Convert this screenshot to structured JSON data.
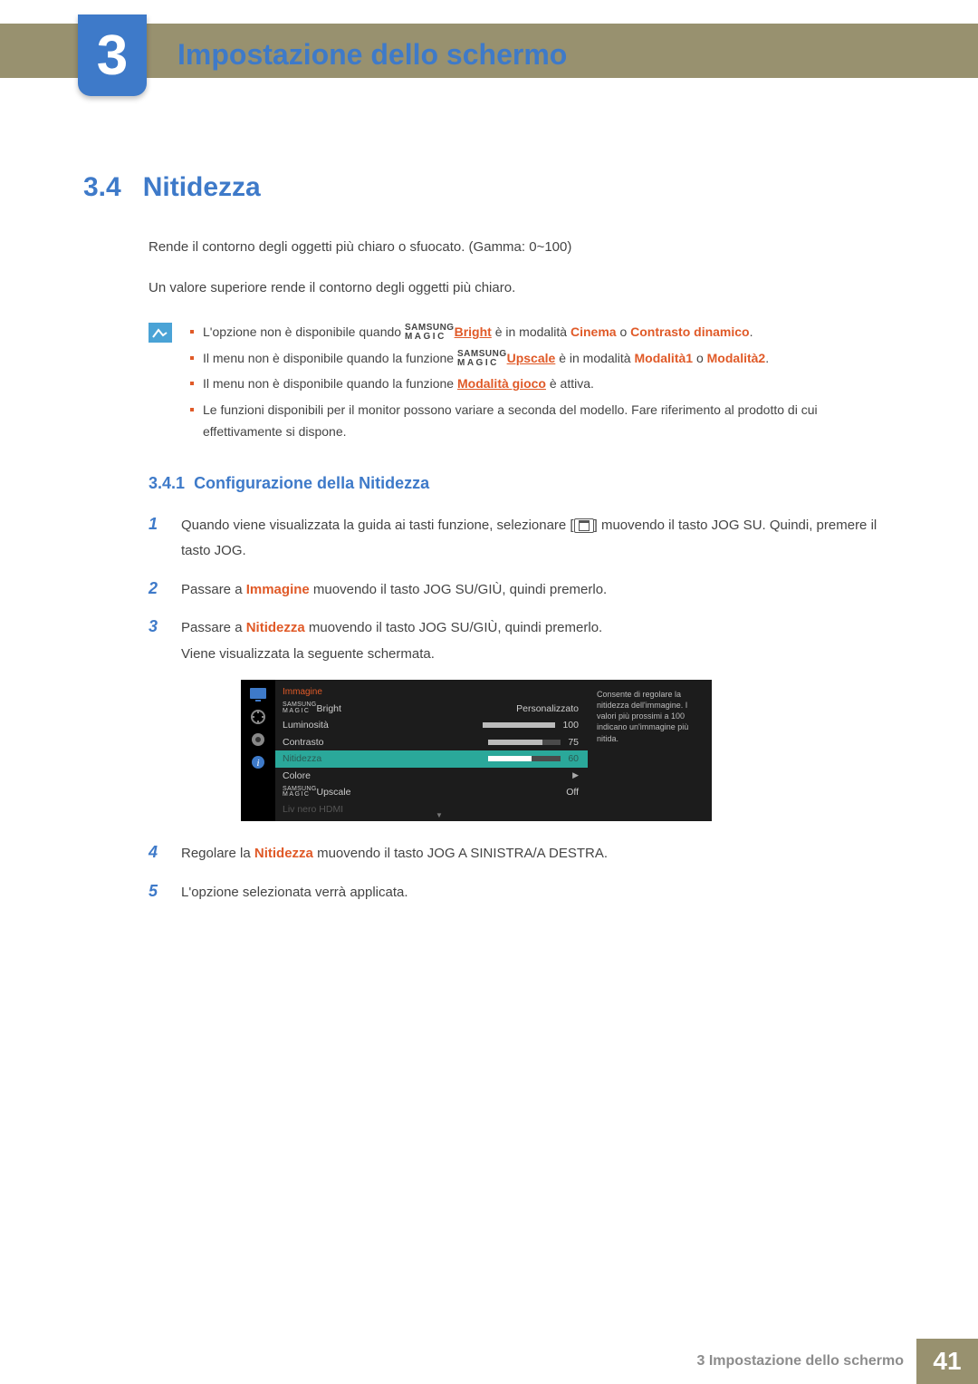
{
  "chapter": {
    "number": "3",
    "title": "Impostazione dello schermo"
  },
  "section": {
    "number": "3.4",
    "title": "Nitidezza",
    "intro1": "Rende il contorno degli oggetti più chiaro o sfuocato. (Gamma: 0~100)",
    "intro2": "Un valore superiore rende il contorno degli oggetti più chiaro."
  },
  "notes": {
    "n1_a": "L'opzione non è disponibile quando ",
    "n1_brand_top": "SAMSUNG",
    "n1_brand_bot": "MAGIC",
    "n1_b": "Bright",
    "n1_c": " è in modalità ",
    "n1_d": "Cinema",
    "n1_e": " o ",
    "n1_f": "Contrasto dinamico",
    "n1_g": ".",
    "n2_a": "Il menu non è disponibile quando la funzione ",
    "n2_b": "Upscale",
    "n2_c": " è in modalità ",
    "n2_d": "Modalità1",
    "n2_e": " o ",
    "n2_f": "Modalità2",
    "n2_g": ".",
    "n3_a": "Il menu non è disponibile quando la funzione ",
    "n3_b": "Modalità gioco",
    "n3_c": " è attiva.",
    "n4": "Le funzioni disponibili per il monitor possono variare a seconda del modello. Fare riferimento al prodotto di cui effettivamente si dispone."
  },
  "subsection": {
    "number": "3.4.1",
    "title": "Configurazione della Nitidezza"
  },
  "steps": {
    "s1_num": "1",
    "s1_a": "Quando viene visualizzata la guida ai tasti funzione, selezionare [",
    "s1_b": "] muovendo il tasto JOG SU. Quindi, premere il tasto JOG.",
    "s2_num": "2",
    "s2_a": "Passare a ",
    "s2_b": "Immagine",
    "s2_c": " muovendo il tasto JOG SU/GIÙ, quindi premerlo.",
    "s3_num": "3",
    "s3_a": "Passare a ",
    "s3_b": "Nitidezza",
    "s3_c": " muovendo il tasto JOG SU/GIÙ, quindi premerlo.",
    "s3_d": "Viene visualizzata la seguente schermata.",
    "s4_num": "4",
    "s4_a": "Regolare la ",
    "s4_b": "Nitidezza",
    "s4_c": " muovendo il tasto JOG A SINISTRA/A DESTRA.",
    "s5_num": "5",
    "s5_a": "L'opzione selezionata verrà applicata."
  },
  "osd": {
    "title": "Immagine",
    "brand_top": "SAMSUNG",
    "brand_bot": "MAGIC",
    "r1_label": "Bright",
    "r1_val": "Personalizzato",
    "r2_label": "Luminosità",
    "r2_val": "100",
    "r3_label": "Contrasto",
    "r3_val": "75",
    "r4_label": "Nitidezza",
    "r4_val": "60",
    "r5_label": "Colore",
    "r6_label": "Upscale",
    "r6_val": "Off",
    "r7_label": "Liv nero HDMI",
    "info": "Consente di regolare la nitidezza dell'immagine. I valori più prossimi a 100 indicano un'immagine più nitida."
  },
  "chart_data": {
    "type": "bar",
    "categories": [
      "Luminosità",
      "Contrasto",
      "Nitidezza"
    ],
    "values": [
      100,
      75,
      60
    ],
    "title": "Immagine",
    "xlabel": "",
    "ylabel": "",
    "ylim": [
      0,
      100
    ]
  },
  "footer": {
    "label": "3 Impostazione dello schermo",
    "page": "41"
  }
}
